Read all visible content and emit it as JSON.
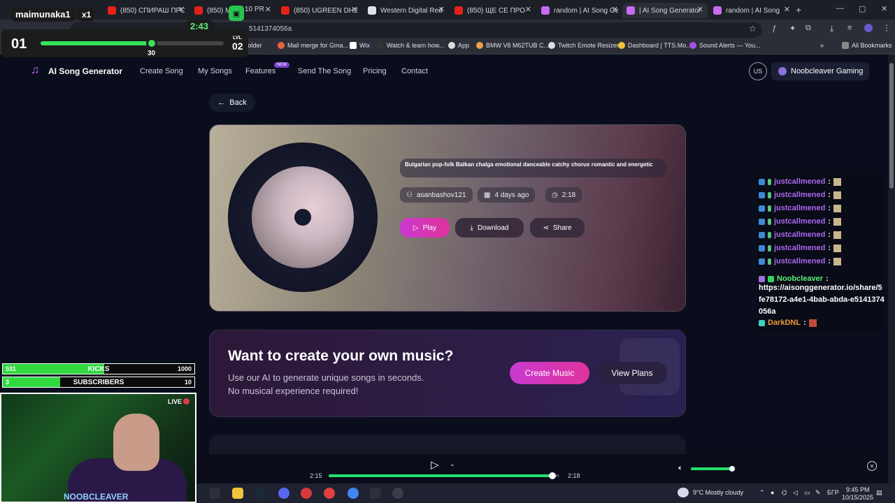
{
  "browser": {
    "tabs": [
      {
        "label": "(850) СПИРАШ ПРО",
        "fav": "#e62117"
      },
      {
        "label": "(850) MY",
        "fav": "#e62117"
      },
      {
        "label": "(850) UGREEN DH23",
        "fav": "#e62117"
      },
      {
        "label": "Western Digital Red F",
        "fav": "#dfe1e6"
      },
      {
        "label": "(850) ЩЕ СЕ ПРО",
        "fav": "#e62117"
      },
      {
        "label": "random | AI Song Ge",
        "fav": "#c76bf0"
      },
      {
        "label": "| AI Song Generator",
        "fav": "#c76bf0"
      },
      {
        "label": "random | AI Song",
        "fav": "#c76bf0"
      }
    ],
    "tab_fragment": "10 PR",
    "url": "5141374056a",
    "bookmarks": [
      "folder",
      "Mail merge for Gma...",
      "Wix",
      "Watch & learn how...",
      "App",
      "BMW V8 M62TUB C...",
      "Twitch Emote Resizer",
      "Dashboard | TTS.Mo...",
      "Sound Alerts — You..."
    ],
    "all_bookmarks": "All Bookmarks"
  },
  "site": {
    "logo": "AI Song Generator",
    "nav": [
      "Create Song",
      "My Songs",
      "Features",
      "Send The Song",
      "Pricing",
      "Contact"
    ],
    "new_badge": "NEW",
    "lang": "US",
    "user": "Noobcleaver Gaming",
    "back": "Back",
    "song": {
      "title": "Bulgarian pop-folk Balkan chalga emotional danceable catchy chorus romantic and energetic",
      "author": "asanbashov121",
      "age": "4 days ago",
      "duration": "2:18",
      "play": "Play",
      "download": "Download",
      "share": "Share"
    },
    "cta": {
      "heading": "Want to create your own music?",
      "line1": "Use our AI to generate unique songs in seconds.",
      "line2": "No musical experience required!",
      "create": "Create Music",
      "plans": "View Plans"
    }
  },
  "player": {
    "current": "2:15",
    "total": "2:18",
    "progress": 0.97,
    "volume": 0.97
  },
  "chat": {
    "repeat_user": "justcallmened",
    "repeat_count": 7,
    "nc_user": "Noobcleaver",
    "nc_msg": "https://aisonggenerator.io/share/5fe78172-a4e1-4bab-abda-e5141374056a",
    "last_user": "DarkDNL"
  },
  "overlay": {
    "name": "maimunaka1",
    "mult": "x1",
    "timer": "2:43",
    "level_num": "01",
    "level_progress": 0.59,
    "marker": "30",
    "lvl_label": "LVL",
    "lvl_value": "02",
    "goals": [
      {
        "left": "531",
        "label": "KICKS",
        "right": "1000",
        "fill": 0.531
      },
      {
        "left": "3",
        "label": "SUBSCRIBERS",
        "right": "10",
        "fill": 0.3
      }
    ],
    "live": "LIVE",
    "brand": "NOOBCLEAVER"
  },
  "taskbar": {
    "weather": "9°C  Mostly cloudy",
    "lang": "БГР",
    "time": "9:45 PM",
    "date": "10/15/2025"
  },
  "colors": {
    "accent_pink": "#e0329c",
    "accent_green": "#22e26a",
    "chat_name": "#a968ef"
  }
}
